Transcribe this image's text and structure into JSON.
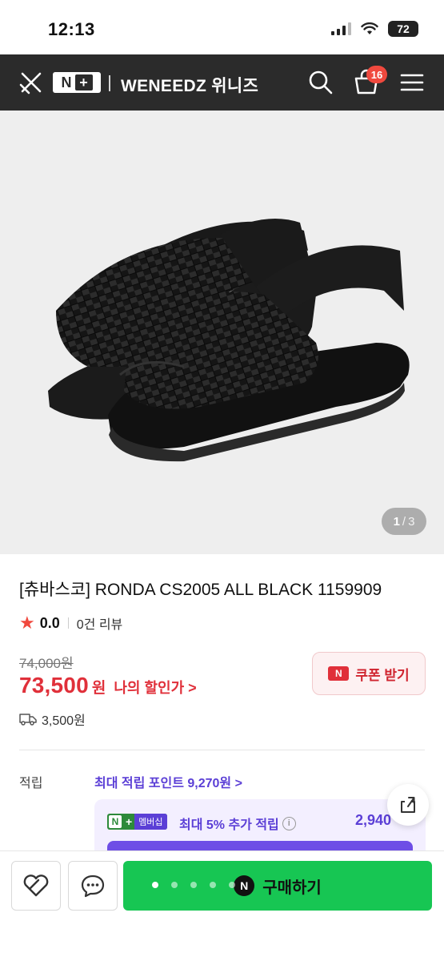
{
  "status_bar": {
    "time": "12:13",
    "battery": "72"
  },
  "header": {
    "logo_text": "N",
    "brand": "WENEEDZ 위니즈",
    "cart_count": "16",
    "icons": [
      "close-icon",
      "search-icon",
      "cart-icon",
      "menu-icon"
    ]
  },
  "gallery": {
    "current": "1",
    "separator": "/",
    "total": "3"
  },
  "product": {
    "title": "[츄바스코] RONDA CS2005 ALL BLACK 1159909",
    "rating": "0.0",
    "review_count": "0건 리뷰",
    "original_price": "74,000원",
    "price": "73,500",
    "currency": "원",
    "my_discount": "나의 할인가 >",
    "coupon_label": "쿠폰 받기",
    "shipping_fee": "3,500원"
  },
  "points": {
    "label": "적립",
    "max_points": "최대 적립 포인트 9,270원 >",
    "membership_badge": "멤버십",
    "membership_text": "최대 5% 추가 적립",
    "membership_points": "2,940"
  },
  "bottom_bar": {
    "buy_label": "구매하기"
  },
  "colors": {
    "accent_red": "#e0303a",
    "brand_green": "#17c653",
    "purple": "#5b3fd6",
    "header_bg": "#2b2b2b"
  }
}
